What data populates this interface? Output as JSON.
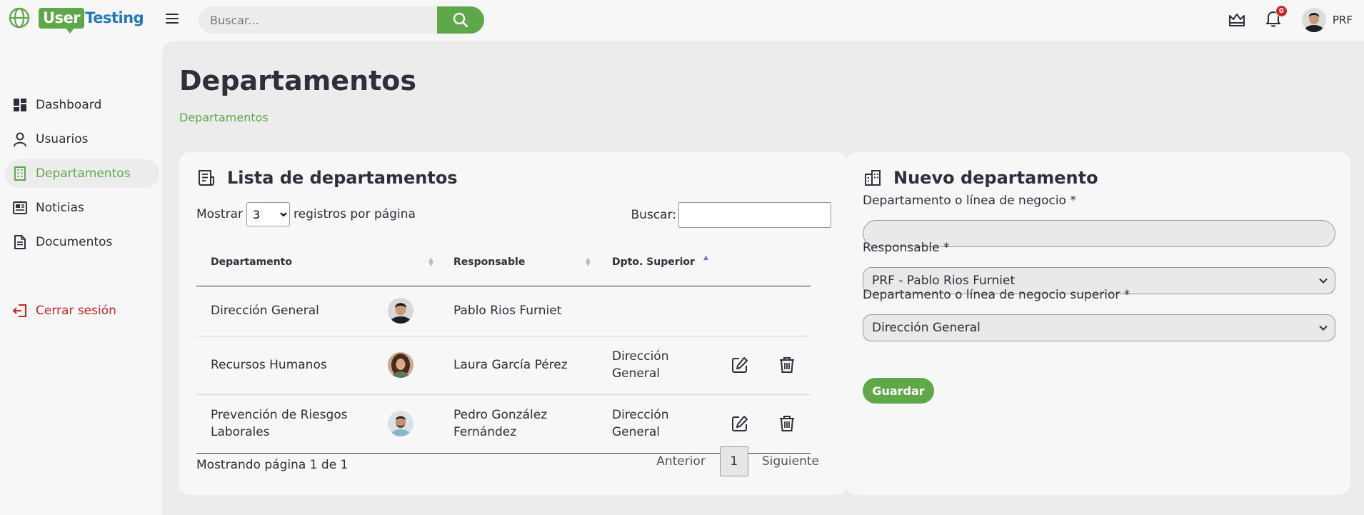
{
  "app": {
    "logo_part1": "User",
    "logo_part2": "Testing",
    "search_placeholder": "Buscar...",
    "notifications_count": "0",
    "user_initials": "PRF"
  },
  "sidebar": {
    "items": [
      {
        "label": "Dashboard",
        "icon": "dashboard-icon"
      },
      {
        "label": "Usuarios",
        "icon": "user-icon"
      },
      {
        "label": "Departamentos",
        "icon": "building-icon",
        "active": true
      },
      {
        "label": "Noticias",
        "icon": "newspaper-icon"
      },
      {
        "label": "Documentos",
        "icon": "document-icon"
      }
    ],
    "logout": "Cerrar sesión"
  },
  "page": {
    "title": "Departamentos",
    "breadcrumb": "Departamentos"
  },
  "list": {
    "title": "Lista de departamentos",
    "show_prefix": "Mostrar",
    "show_value": "3",
    "show_suffix": "registros por página",
    "search_label": "Buscar:",
    "columns": [
      "Departamento",
      "Responsable",
      "Dpto. Superior"
    ],
    "rows": [
      {
        "department": "Dirección General",
        "responsible": "Pablo Rios Furniet",
        "superior": ""
      },
      {
        "department": "Recursos Humanos",
        "responsible": "Laura García Pérez",
        "superior": "Dirección General"
      },
      {
        "department": "Prevención de Riesgos Laborales",
        "responsible": "Pedro González Fernández",
        "superior": "Dirección General"
      }
    ],
    "footer_info": "Mostrando página 1 de 1",
    "prev": "Anterior",
    "page": "1",
    "next": "Siguiente"
  },
  "form": {
    "title": "Nuevo departamento",
    "dept_label": "Departamento o línea de negocio *",
    "dept_value": "",
    "responsible_label": "Responsable *",
    "responsible_value": "PRF - Pablo Rios Furniet",
    "superior_label": "Departamento o línea de negocio superior *",
    "superior_value": "Dirección General",
    "save": "Guardar"
  },
  "colors": {
    "accent": "#5fa84a",
    "brand_blue": "#2476b8",
    "danger": "#c82626",
    "text": "#2d2f3a"
  }
}
